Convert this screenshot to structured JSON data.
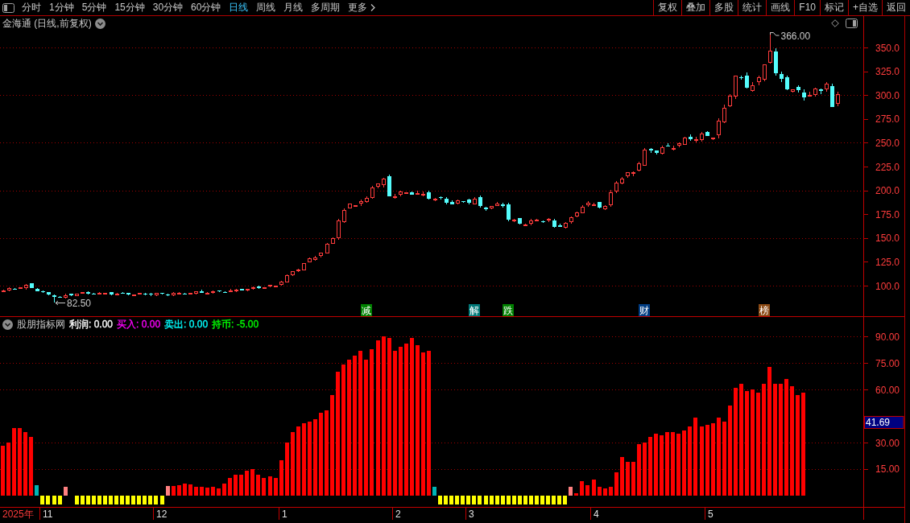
{
  "toolbar": {
    "periods": [
      {
        "label": "分时",
        "selected": false
      },
      {
        "label": "1分钟",
        "selected": false
      },
      {
        "label": "5分钟",
        "selected": false
      },
      {
        "label": "15分钟",
        "selected": false
      },
      {
        "label": "30分钟",
        "selected": false
      },
      {
        "label": "60分钟",
        "selected": false
      },
      {
        "label": "日线",
        "selected": true
      },
      {
        "label": "周线",
        "selected": false
      },
      {
        "label": "月线",
        "selected": false
      },
      {
        "label": "多周期",
        "selected": false
      }
    ],
    "more": "更多",
    "actions": [
      "复权",
      "叠加",
      "多股",
      "统计",
      "画线",
      "F10",
      "标记",
      "+自选",
      "返回"
    ]
  },
  "price_panel": {
    "title": "金海通 (日线,前复权)",
    "axis_labels": [
      "350.0",
      "325.0",
      "300.0",
      "275.0",
      "250.0",
      "225.0",
      "200.0",
      "175.0",
      "150.0",
      "125.0",
      "100.0"
    ],
    "high_label": "366.00",
    "low_label": "82.50",
    "events": [
      {
        "label": "减",
        "color": "#008000"
      },
      {
        "label": "解",
        "color": "#007878"
      },
      {
        "label": "跌",
        "color": "#008000"
      },
      {
        "label": "财",
        "color": "#003c82"
      },
      {
        "label": "榜",
        "color": "#8c4a14"
      }
    ]
  },
  "indicator_panel": {
    "name": "股朋指标网",
    "legend": [
      {
        "label": "利润: 0.00",
        "color": "#ffffff"
      },
      {
        "label": "买入: 0.00",
        "color": "#ff00ff"
      },
      {
        "label": "卖出: 0.00",
        "color": "#00ffff"
      },
      {
        "label": "持币: -5.00",
        "color": "#00ff00"
      }
    ],
    "value_tag": "41.69",
    "chart_data": {
      "type": "bar",
      "grid": true,
      "ylim": [
        -6.4,
        92.8
      ],
      "yticks": [
        {
          "value": 15,
          "label": "15.00"
        },
        {
          "value": 30,
          "label": "30.00"
        },
        {
          "value": 60,
          "label": "60.00"
        },
        {
          "value": 75,
          "label": "75.00"
        },
        {
          "value": 90,
          "label": "90.00"
        }
      ],
      "series": [
        {
          "color": "#ff0000",
          "values": [
            28,
            30,
            38,
            38,
            36,
            33,
            null,
            null,
            null,
            null,
            null,
            null,
            null,
            null,
            null,
            null,
            null,
            null,
            null,
            null,
            null,
            null,
            null,
            null,
            null,
            null,
            null,
            null,
            null,
            null,
            5.5,
            6,
            7,
            6.5,
            5,
            5,
            4.5,
            5,
            4,
            7,
            10,
            12,
            12,
            14,
            15,
            12,
            10,
            11,
            10,
            20,
            30,
            36,
            39,
            41,
            42,
            43,
            47,
            48,
            57,
            70,
            74,
            77,
            79,
            82,
            77,
            83,
            88,
            90,
            89,
            82,
            84,
            86,
            89,
            85,
            81,
            82,
            null,
            null,
            null,
            null,
            null,
            null,
            null,
            null,
            null,
            null,
            null,
            null,
            null,
            null,
            null,
            null,
            null,
            null,
            null,
            null,
            null,
            null,
            null,
            null,
            null,
            1.5,
            8,
            6,
            9,
            5,
            4,
            5,
            13,
            22,
            19,
            19,
            29,
            30,
            33,
            35,
            34,
            36,
            36,
            35,
            37,
            39,
            44,
            39,
            40,
            41,
            44,
            42,
            51,
            61,
            63,
            59,
            60,
            58,
            63,
            73,
            63,
            63,
            66,
            62,
            57,
            58,
            null,
            null,
            null,
            null,
            null,
            null,
            null,
            null,
            null,
            null
          ]
        },
        {
          "color": "#ff8080",
          "values": [
            null,
            null,
            null,
            null,
            null,
            null,
            null,
            null,
            null,
            null,
            null,
            5,
            null,
            null,
            null,
            null,
            null,
            null,
            null,
            null,
            null,
            null,
            null,
            null,
            null,
            null,
            null,
            null,
            null,
            5.5,
            null,
            null,
            null,
            null,
            null,
            null,
            null,
            null,
            null,
            null,
            null,
            null,
            null,
            null,
            null,
            null,
            null,
            null,
            null,
            null,
            null,
            null,
            null,
            null,
            null,
            null,
            null,
            null,
            null,
            null,
            null,
            null,
            null,
            null,
            null,
            null,
            null,
            null,
            null,
            null,
            null,
            null,
            null,
            null,
            null,
            null,
            null,
            null,
            null,
            null,
            null,
            null,
            null,
            null,
            null,
            null,
            null,
            null,
            null,
            null,
            null,
            null,
            null,
            null,
            null,
            null,
            null,
            null,
            null,
            null,
            5,
            null,
            null,
            null,
            null,
            null,
            null,
            null,
            null,
            null,
            null,
            null,
            null,
            null,
            null,
            null,
            null,
            null,
            null,
            null,
            null,
            null,
            null,
            null,
            null,
            null,
            null,
            null,
            null,
            null,
            null,
            null,
            null,
            null,
            null,
            null,
            null,
            null,
            null,
            null,
            null,
            null,
            null,
            null,
            null,
            null,
            null,
            null,
            null,
            null,
            null,
            null
          ]
        },
        {
          "color": "#00b4b4",
          "values": [
            null,
            null,
            null,
            null,
            null,
            null,
            6,
            null,
            null,
            null,
            null,
            null,
            null,
            null,
            null,
            null,
            null,
            null,
            null,
            null,
            null,
            null,
            null,
            null,
            null,
            null,
            null,
            null,
            null,
            null,
            null,
            null,
            null,
            null,
            null,
            null,
            null,
            null,
            null,
            null,
            null,
            null,
            null,
            null,
            null,
            null,
            null,
            null,
            null,
            null,
            null,
            null,
            null,
            null,
            null,
            null,
            null,
            null,
            null,
            null,
            null,
            null,
            null,
            null,
            null,
            null,
            null,
            null,
            null,
            null,
            null,
            null,
            null,
            null,
            null,
            null,
            5,
            null,
            null,
            null,
            null,
            null,
            null,
            null,
            null,
            null,
            null,
            null,
            null,
            null,
            null,
            null,
            null,
            null,
            null,
            null,
            null,
            null,
            null,
            null,
            null,
            null,
            null,
            null,
            null,
            null,
            null,
            null,
            null,
            null,
            null,
            null,
            null,
            null,
            null,
            null,
            null,
            null,
            null,
            null,
            null,
            null,
            null,
            null,
            null,
            null,
            null,
            null,
            null,
            null,
            null,
            null,
            null,
            null,
            null,
            null,
            null,
            null,
            null,
            null,
            null,
            null,
            null,
            null,
            null,
            null,
            null,
            null,
            null,
            null,
            null,
            null
          ]
        },
        {
          "color": "#ffff00",
          "values": [
            null,
            null,
            null,
            null,
            null,
            null,
            null,
            -5,
            -5,
            -5,
            -5,
            null,
            null,
            -5,
            -5,
            -5,
            -5,
            -5,
            -5,
            -5,
            -5,
            -5,
            -5,
            -5,
            -5,
            -5,
            -5,
            -5,
            -5,
            null,
            null,
            null,
            null,
            null,
            null,
            null,
            null,
            null,
            null,
            null,
            null,
            null,
            null,
            null,
            null,
            null,
            null,
            null,
            null,
            null,
            null,
            null,
            null,
            null,
            null,
            null,
            null,
            null,
            null,
            null,
            null,
            null,
            null,
            null,
            null,
            null,
            null,
            null,
            null,
            null,
            null,
            null,
            null,
            null,
            null,
            null,
            null,
            -5,
            -5,
            -5,
            -5,
            -5,
            -5,
            -5,
            -5,
            -5,
            -5,
            -5,
            -5,
            -5,
            -5,
            -5,
            -5,
            -5,
            -5,
            -5,
            -5,
            -5,
            -5,
            -5,
            null,
            null,
            null,
            null,
            null,
            null,
            null,
            null,
            null,
            null,
            null,
            null,
            null,
            null,
            null,
            null,
            null,
            null,
            null,
            null,
            null,
            null,
            null,
            null,
            null,
            null,
            null,
            null,
            null,
            null,
            null,
            null,
            null,
            null,
            null,
            null,
            null,
            null,
            null,
            null,
            null,
            null,
            null,
            null,
            null,
            null,
            null,
            null,
            null,
            null,
            null,
            null
          ]
        }
      ]
    }
  },
  "time_axis": {
    "year": "2025年",
    "months": [
      {
        "label": "11"
      },
      {
        "label": "12"
      },
      {
        "label": "1"
      },
      {
        "label": "2"
      },
      {
        "label": "3"
      },
      {
        "label": "4"
      },
      {
        "label": "5"
      }
    ]
  }
}
